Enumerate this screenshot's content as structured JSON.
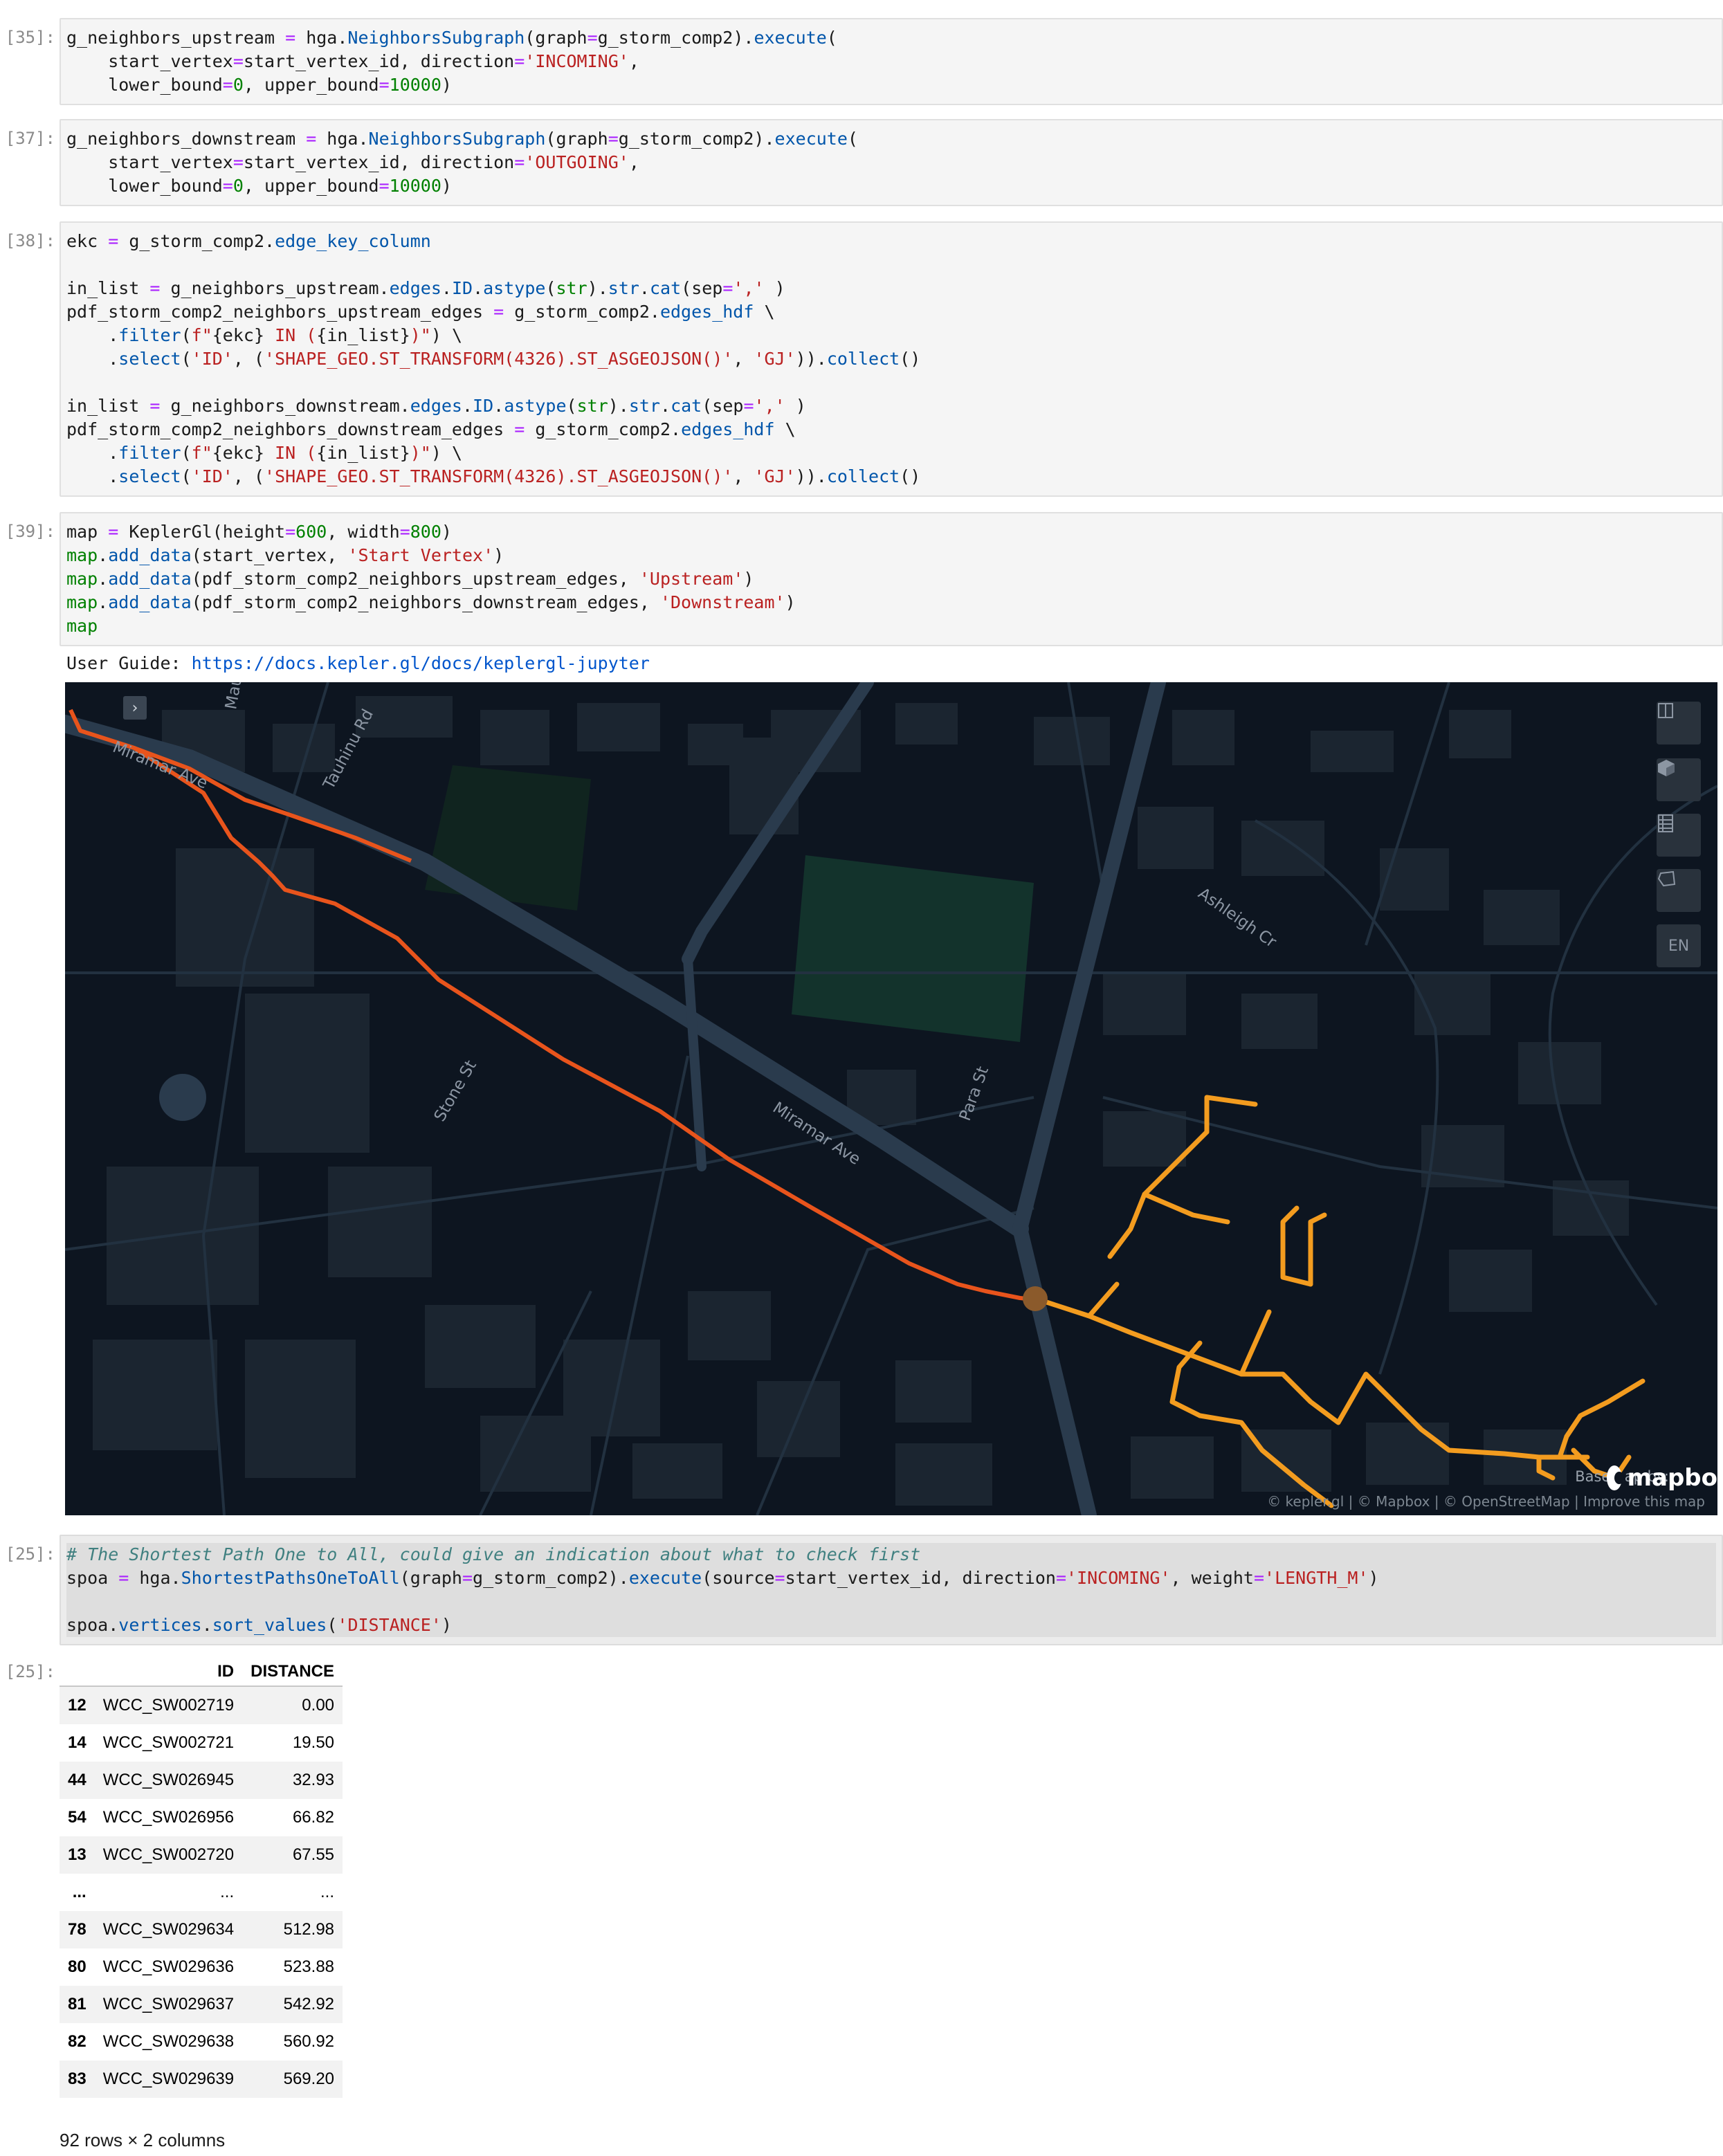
{
  "cells": {
    "c35": {
      "prompt": "[35]:"
    },
    "c37": {
      "prompt": "[37]:"
    },
    "c38": {
      "prompt": "[38]:"
    },
    "c39": {
      "prompt": "[39]:"
    },
    "c25": {
      "prompt": "[25]:"
    },
    "out25": {
      "prompt": "[25]:"
    }
  },
  "user_guide": {
    "label": "User Guide:",
    "link": "https://docs.kepler.gl/docs/keplergl-jupyter"
  },
  "map": {
    "streets": [
      "Maui",
      "Tauhinu Rd",
      "Miramar Ave",
      "Ashleigh Cr",
      "Stone St",
      "Para St",
      "Miramar Ave"
    ],
    "controls": [
      "split-map",
      "layer-3d",
      "data-table",
      "draw-polygon",
      "EN"
    ],
    "basemap_label": "Basemap by:",
    "mapbox_label": "mapbo",
    "attribution": "© kepler.gl | © Mapbox | © OpenStreetMap | Improve this map",
    "colors": {
      "upstream": "#e8541c",
      "downstream": "#f39c1f",
      "vertex": "#8b5a2b",
      "background": "#0d1520",
      "road": "#2a3b4d"
    }
  },
  "table": {
    "columns": [
      "",
      "ID",
      "DISTANCE"
    ],
    "rows": [
      [
        "12",
        "WCC_SW002719",
        "0.00"
      ],
      [
        "14",
        "WCC_SW002721",
        "19.50"
      ],
      [
        "44",
        "WCC_SW026945",
        "32.93"
      ],
      [
        "54",
        "WCC_SW026956",
        "66.82"
      ],
      [
        "13",
        "WCC_SW002720",
        "67.55"
      ],
      [
        "...",
        "...",
        "..."
      ],
      [
        "78",
        "WCC_SW029634",
        "512.98"
      ],
      [
        "80",
        "WCC_SW029636",
        "523.88"
      ],
      [
        "81",
        "WCC_SW029637",
        "542.92"
      ],
      [
        "82",
        "WCC_SW029638",
        "560.92"
      ],
      [
        "83",
        "WCC_SW029639",
        "569.20"
      ]
    ],
    "shape": "92 rows × 2 columns"
  }
}
